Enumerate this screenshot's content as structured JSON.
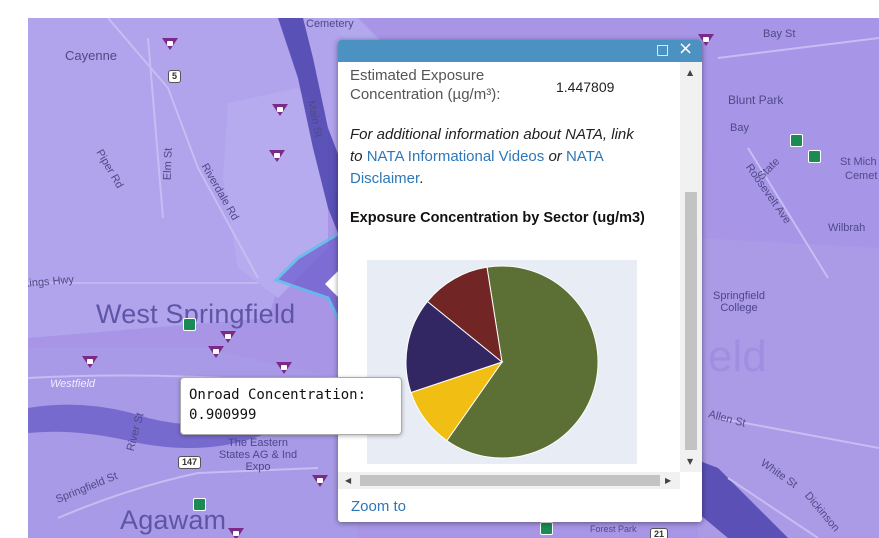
{
  "map": {
    "streets": [
      "Cemetery",
      "Cayenne",
      "Bay St",
      "Blunt Park",
      "Bay",
      "Piper Rd",
      "Elm St",
      "Riverdale Rd",
      "Main St",
      "Roosevelt Ave",
      "State",
      "St Mich",
      "Cemet",
      "Wilbrah",
      "Kings Hwy",
      "Westfield",
      "River St",
      "Allen St",
      "White St",
      "Springfield St",
      "Dickinson",
      "Forest Park"
    ],
    "places": {
      "west_springfield": "West Springfield",
      "springfield_partial": "eld",
      "agawam": "Agawam",
      "springfield_college": "Springfield College",
      "eastern_states": "The Eastern States AG & Ind Expo"
    },
    "route_shields": [
      "5",
      "147",
      "21"
    ],
    "colors": {
      "base": "#a995e6",
      "river": "#3e3aa8",
      "selected_outline": "#4fc4ec"
    }
  },
  "popup": {
    "field_label": "Estimated Exposure Concentration (µg/m³):",
    "field_value": "1.447809",
    "info_prefix": "For additional information about NATA, link to ",
    "link1": "NATA Informational Videos",
    "info_mid": " or ",
    "link2": "NATA Disclaimer",
    "info_suffix": ".",
    "chart_title": "Exposure Concentration by Sector (ug/m3)",
    "zoom_label": "Zoom to",
    "maximize_icon": "□",
    "close_icon": "×"
  },
  "tooltip": {
    "label": "Onroad Concentration:",
    "value": "0.900999"
  },
  "chart_data": {
    "type": "pie",
    "title": "Exposure Concentration by Sector (ug/m3)",
    "slices": [
      {
        "value": 0.900999,
        "color": "#5c6f34"
      },
      {
        "value": 0.1465,
        "color": "#f1be14"
      },
      {
        "value": 0.2317,
        "color": "#322763"
      },
      {
        "value": 0.1686,
        "color": "#722525"
      }
    ],
    "start_angle_deg": -99
  }
}
